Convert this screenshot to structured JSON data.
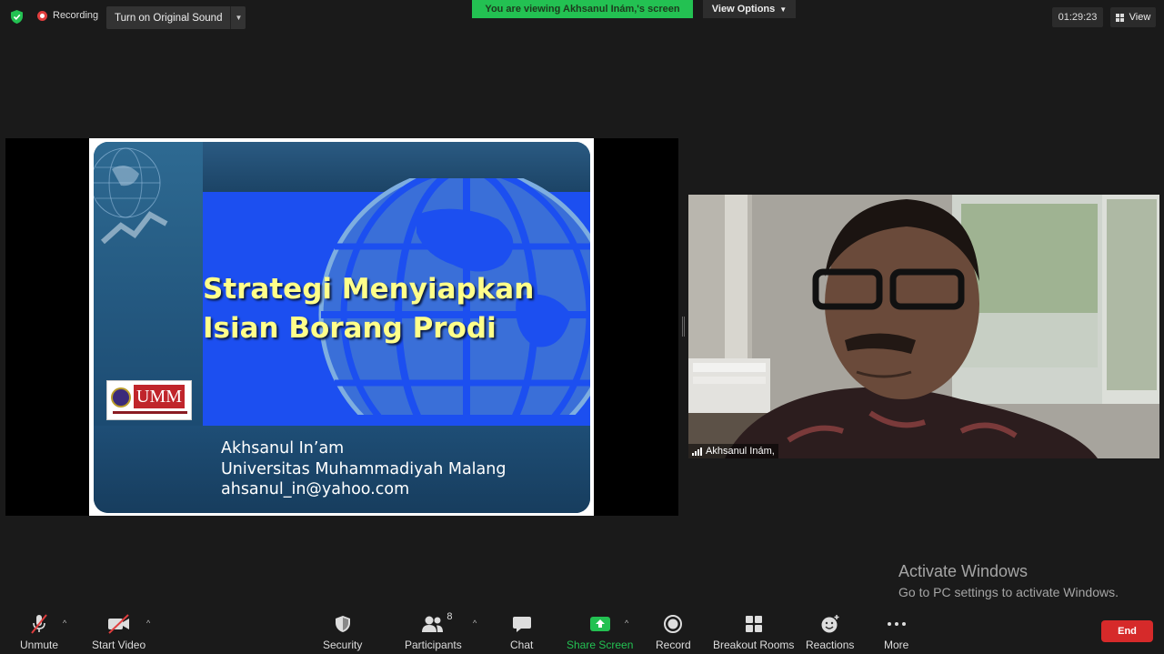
{
  "topbar": {
    "recording_label": "Recording",
    "sound_button": "Turn on Original Sound",
    "viewing_banner": "You are viewing Akhsanul Inám,'s screen",
    "view_options": "View Options",
    "timer": "01:29:23",
    "view_label": "View"
  },
  "slide": {
    "title_line1": "Strategi Menyiapkan",
    "title_line2": "Isian Borang Prodi",
    "author": "Akhsanul In’am",
    "university": "Universitas Muhammadiyah Malang",
    "email": "ahsanul_in@yahoo.com",
    "logo_text": "UMM"
  },
  "video": {
    "participant_name": "Akhsanul Inám,"
  },
  "watermark": {
    "line1": "Activate Windows",
    "line2": "Go to PC settings to activate Windows."
  },
  "toolbar": {
    "unmute": "Unmute",
    "start_video": "Start Video",
    "security": "Security",
    "participants": "Participants",
    "participant_count": "8",
    "chat": "Chat",
    "share_screen": "Share Screen",
    "record": "Record",
    "breakout_rooms": "Breakout Rooms",
    "reactions": "Reactions",
    "more": "More",
    "end": "End"
  },
  "colors": {
    "background": "#1a1a1a",
    "viewing_banner": "#23c152",
    "share_green": "#23c152",
    "end_red": "#d62a2a",
    "slide_blue": "#1c4ff0",
    "slide_title": "#ffff8a"
  }
}
